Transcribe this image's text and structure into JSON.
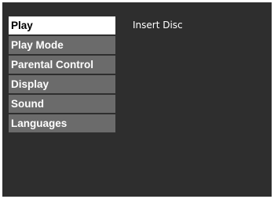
{
  "menu": {
    "items": [
      {
        "label": "Play",
        "selected": true
      },
      {
        "label": "Play Mode",
        "selected": false
      },
      {
        "label": "Parental Control",
        "selected": false
      },
      {
        "label": "Display",
        "selected": false
      },
      {
        "label": "Sound",
        "selected": false
      },
      {
        "label": "Languages",
        "selected": false
      }
    ]
  },
  "content": {
    "status": "Insert Disc"
  },
  "colors": {
    "background": "#2e2e2e",
    "item_background": "#6b6b6b",
    "selected_background": "#ffffff",
    "text": "#ffffff",
    "selected_text": "#000000"
  }
}
